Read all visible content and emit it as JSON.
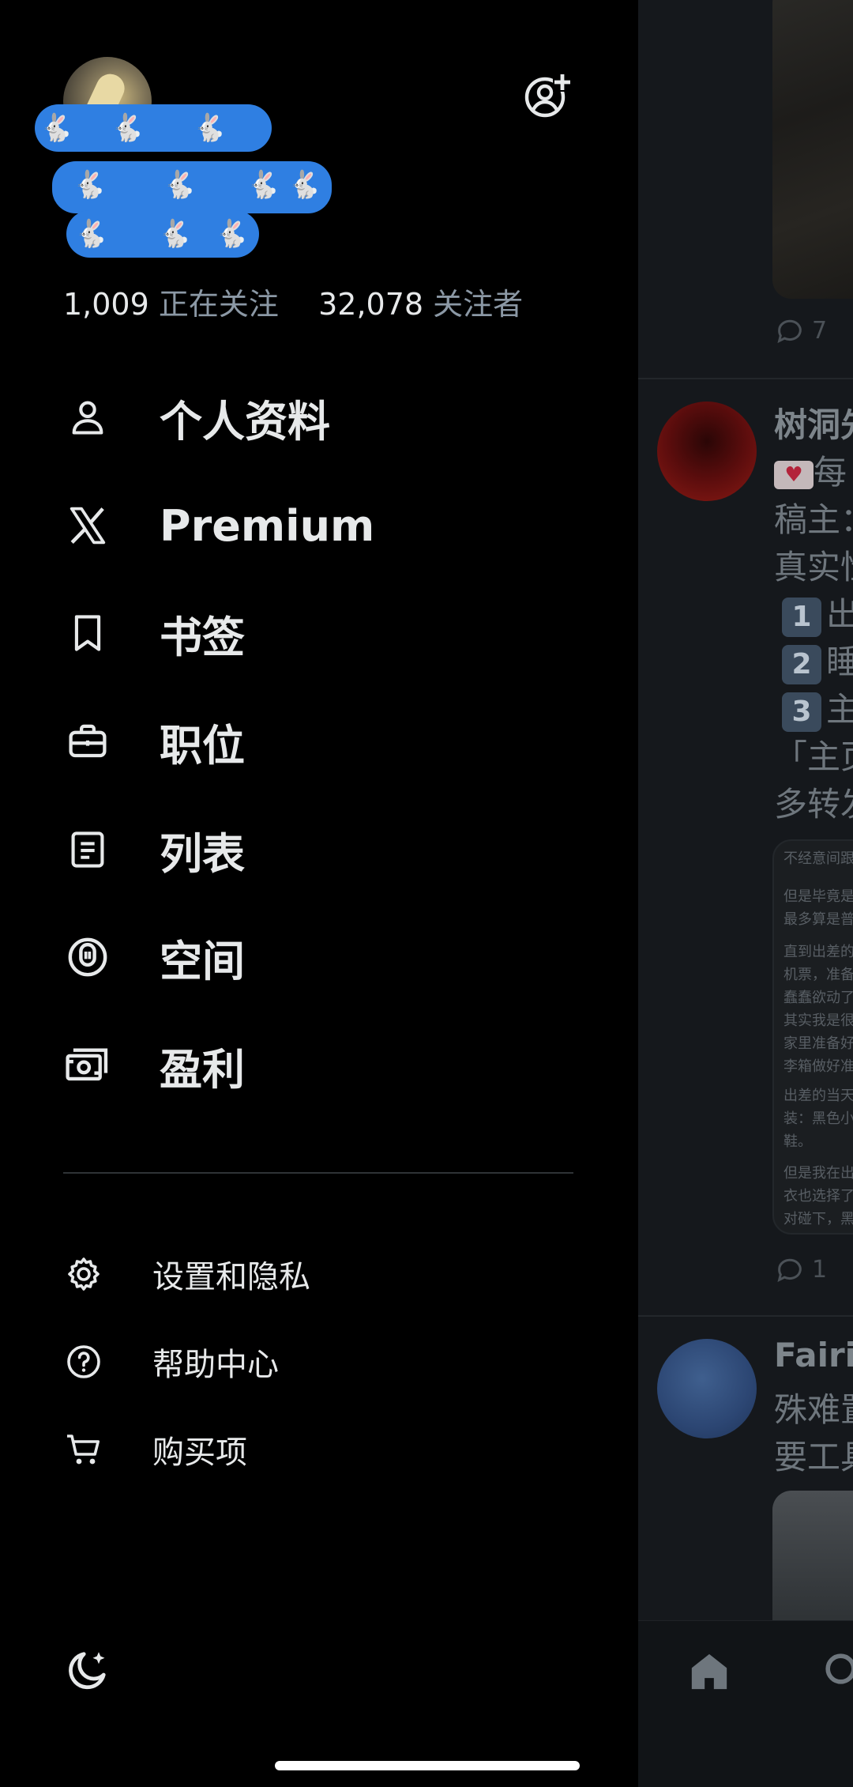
{
  "drawer": {
    "stats": {
      "following_count": "1,009",
      "following_label": "正在关注",
      "followers_count": "32,078",
      "followers_label": "关注者"
    },
    "menu": [
      {
        "label": "个人资料",
        "icon": "person-icon"
      },
      {
        "label": "Premium",
        "icon": "x-logo-icon"
      },
      {
        "label": "书签",
        "icon": "bookmark-icon"
      },
      {
        "label": "职位",
        "icon": "briefcase-icon"
      },
      {
        "label": "列表",
        "icon": "list-icon"
      },
      {
        "label": "空间",
        "icon": "spaces-icon"
      },
      {
        "label": "盈利",
        "icon": "monetization-icon"
      }
    ],
    "secondary": [
      {
        "label": "设置和隐私",
        "icon": "gear-icon"
      },
      {
        "label": "帮助中心",
        "icon": "help-icon"
      },
      {
        "label": "购买项",
        "icon": "cart-icon"
      }
    ],
    "theme_icon": "moon-sparkle-icon",
    "add_account_icon": "add-account-icon"
  },
  "feed": {
    "post1": {
      "reply_count": "7"
    },
    "post2": {
      "author": "树洞先",
      "line1": "每",
      "line2": "稿主：",
      "line3": "真实性",
      "item1_num": "1",
      "item1_text": "出",
      "item2_num": "2",
      "item2_text": "睡",
      "item3_num": "3",
      "item3_text": "主",
      "line4": "「主页",
      "line5": "多转发",
      "shot_p1": "不经意间跟",
      "shot_p2": "但是毕竟是\n最多算是普",
      "shot_p3": "直到出差的\n机票，准备\n蠢蠢欲动了\n其实我是很\n家里准备好\n李箱做好准",
      "shot_p4": "出差的当天\n装：黑色小\n鞋。",
      "shot_p5": "但是我在出\n衣也选择了\n对碰下，黑",
      "reply_count": "1"
    },
    "post3": {
      "author": "Fairie",
      "line1": "殊难置",
      "line2": "要工具"
    }
  },
  "colors": {
    "drawer_bg": "#000000",
    "text_primary": "#e7e9ea",
    "text_secondary": "#8b98a5",
    "scribble_blue": "#2f7fe2"
  }
}
